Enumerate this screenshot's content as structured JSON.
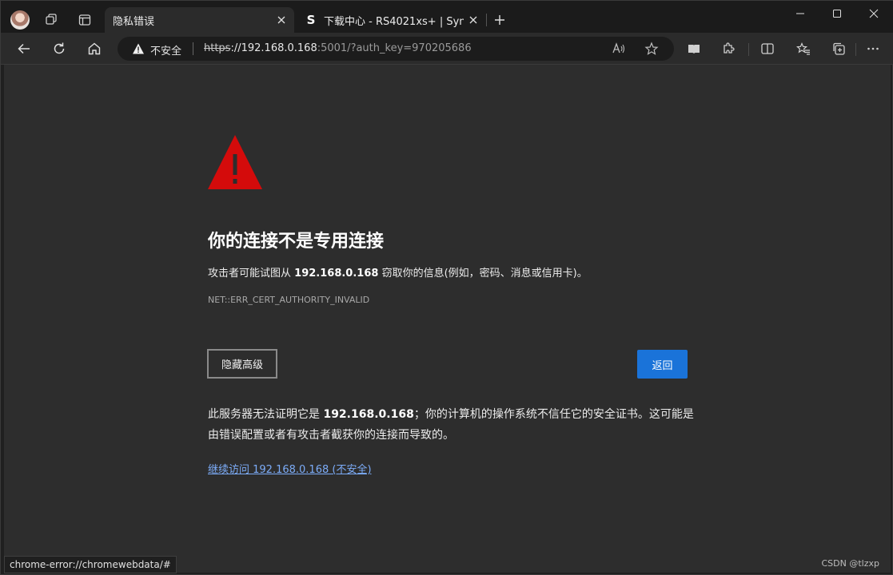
{
  "browser": {
    "tabs": [
      {
        "label": "隐私错误",
        "active": true
      },
      {
        "label": "下载中心 - RS4021xs+ | Synology",
        "active": false,
        "favicon": "S"
      }
    ],
    "address": {
      "security_label": "不安全",
      "url_scheme": "https",
      "url_host": "://192.168.0.168",
      "url_rest": ":5001/?auth_key=970205686"
    }
  },
  "page": {
    "heading": "你的连接不是专用连接",
    "summary_prefix": "攻击者可能试图从",
    "summary_host": "192.168.0.168",
    "summary_suffix": "窃取你的信息(例如，密码、消息或信用卡)。",
    "error_code": "NET::ERR_CERT_AUTHORITY_INVALID",
    "hide_advanced_label": "隐藏高级",
    "back_label": "返回",
    "detail_prefix": "此服务器无法证明它是",
    "detail_host": "192.168.0.168",
    "detail_suffix": "；你的计算机的操作系统不信任它的安全证书。这可能是由错误配置或者有攻击者截获你的连接而导致的。",
    "proceed_link": "继续访问 192.168.0.168 (不安全)"
  },
  "status_bar": "chrome-error://chromewebdata/#",
  "watermark": "CSDN @tlzxp",
  "colors": {
    "accent": "#1a73d9",
    "warning_red": "#d40b0b",
    "link": "#7cacf8"
  }
}
